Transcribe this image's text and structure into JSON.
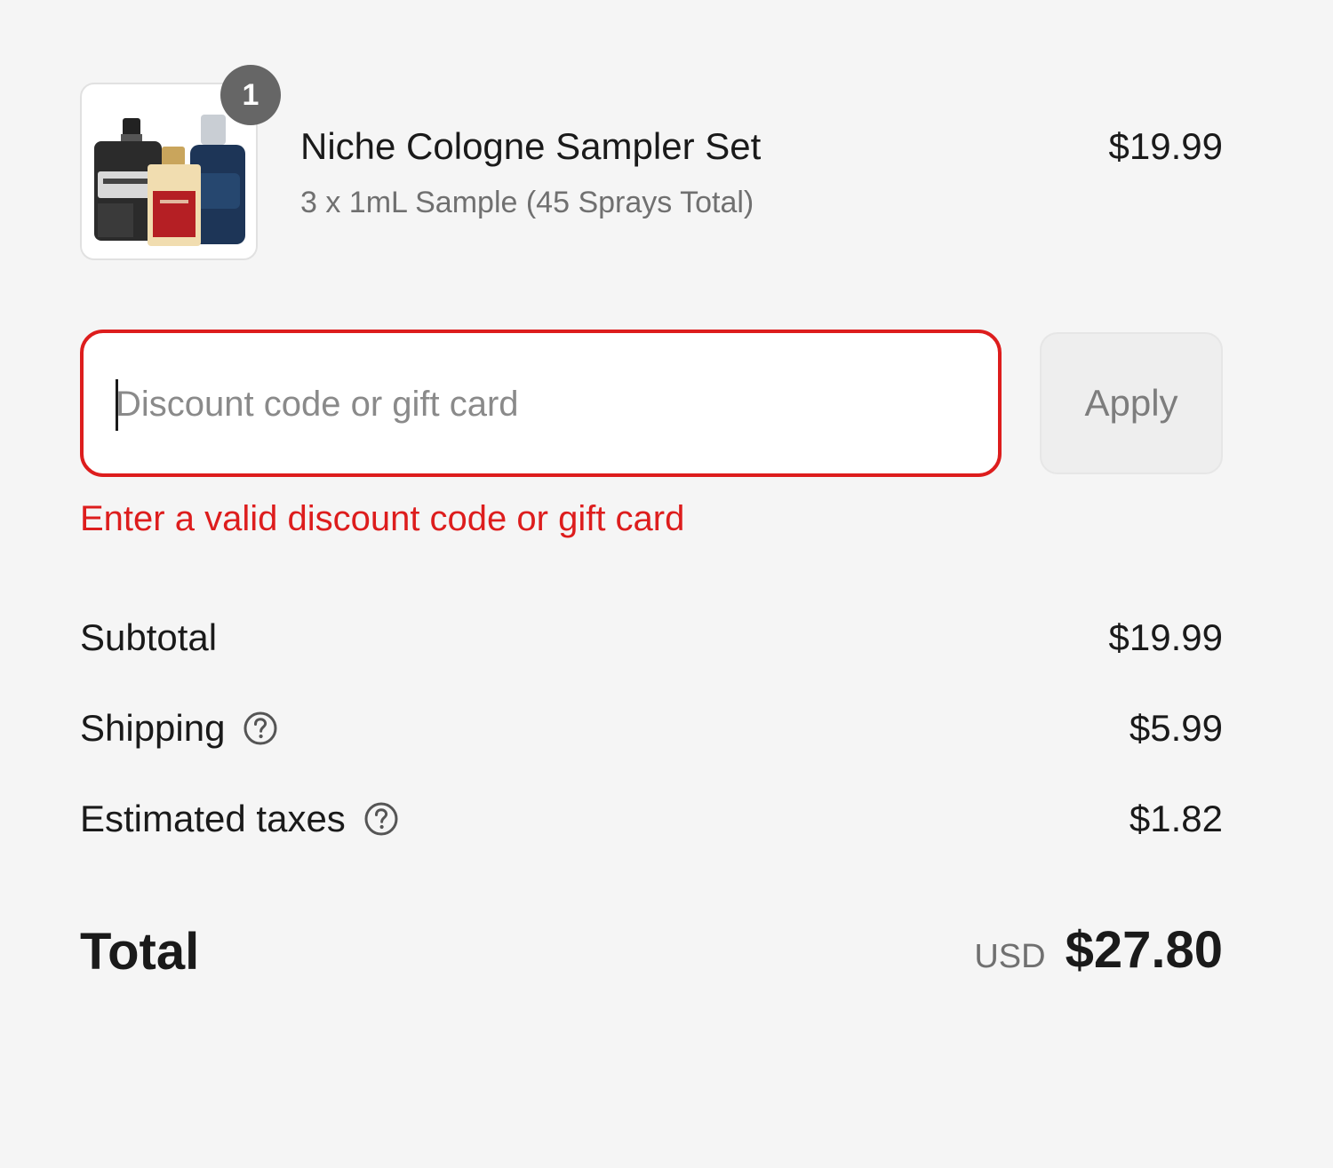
{
  "product": {
    "title": "Niche Cologne Sampler Set",
    "variant": "3 x 1mL Sample (45 Sprays Total)",
    "price": "$19.99",
    "quantity": "1",
    "image_icon": "cologne-bottles-image"
  },
  "discount": {
    "placeholder": "Discount code or gift card",
    "value": "",
    "apply_label": "Apply",
    "error": "Enter a valid discount code or gift card",
    "error_color": "#dd1d1d"
  },
  "summary": {
    "subtotal_label": "Subtotal",
    "subtotal_value": "$19.99",
    "shipping_label": "Shipping",
    "shipping_value": "$5.99",
    "taxes_label": "Estimated taxes",
    "taxes_value": "$1.82",
    "help_icon": "question-circle-icon"
  },
  "total": {
    "label": "Total",
    "currency": "USD",
    "amount": "$27.80"
  }
}
